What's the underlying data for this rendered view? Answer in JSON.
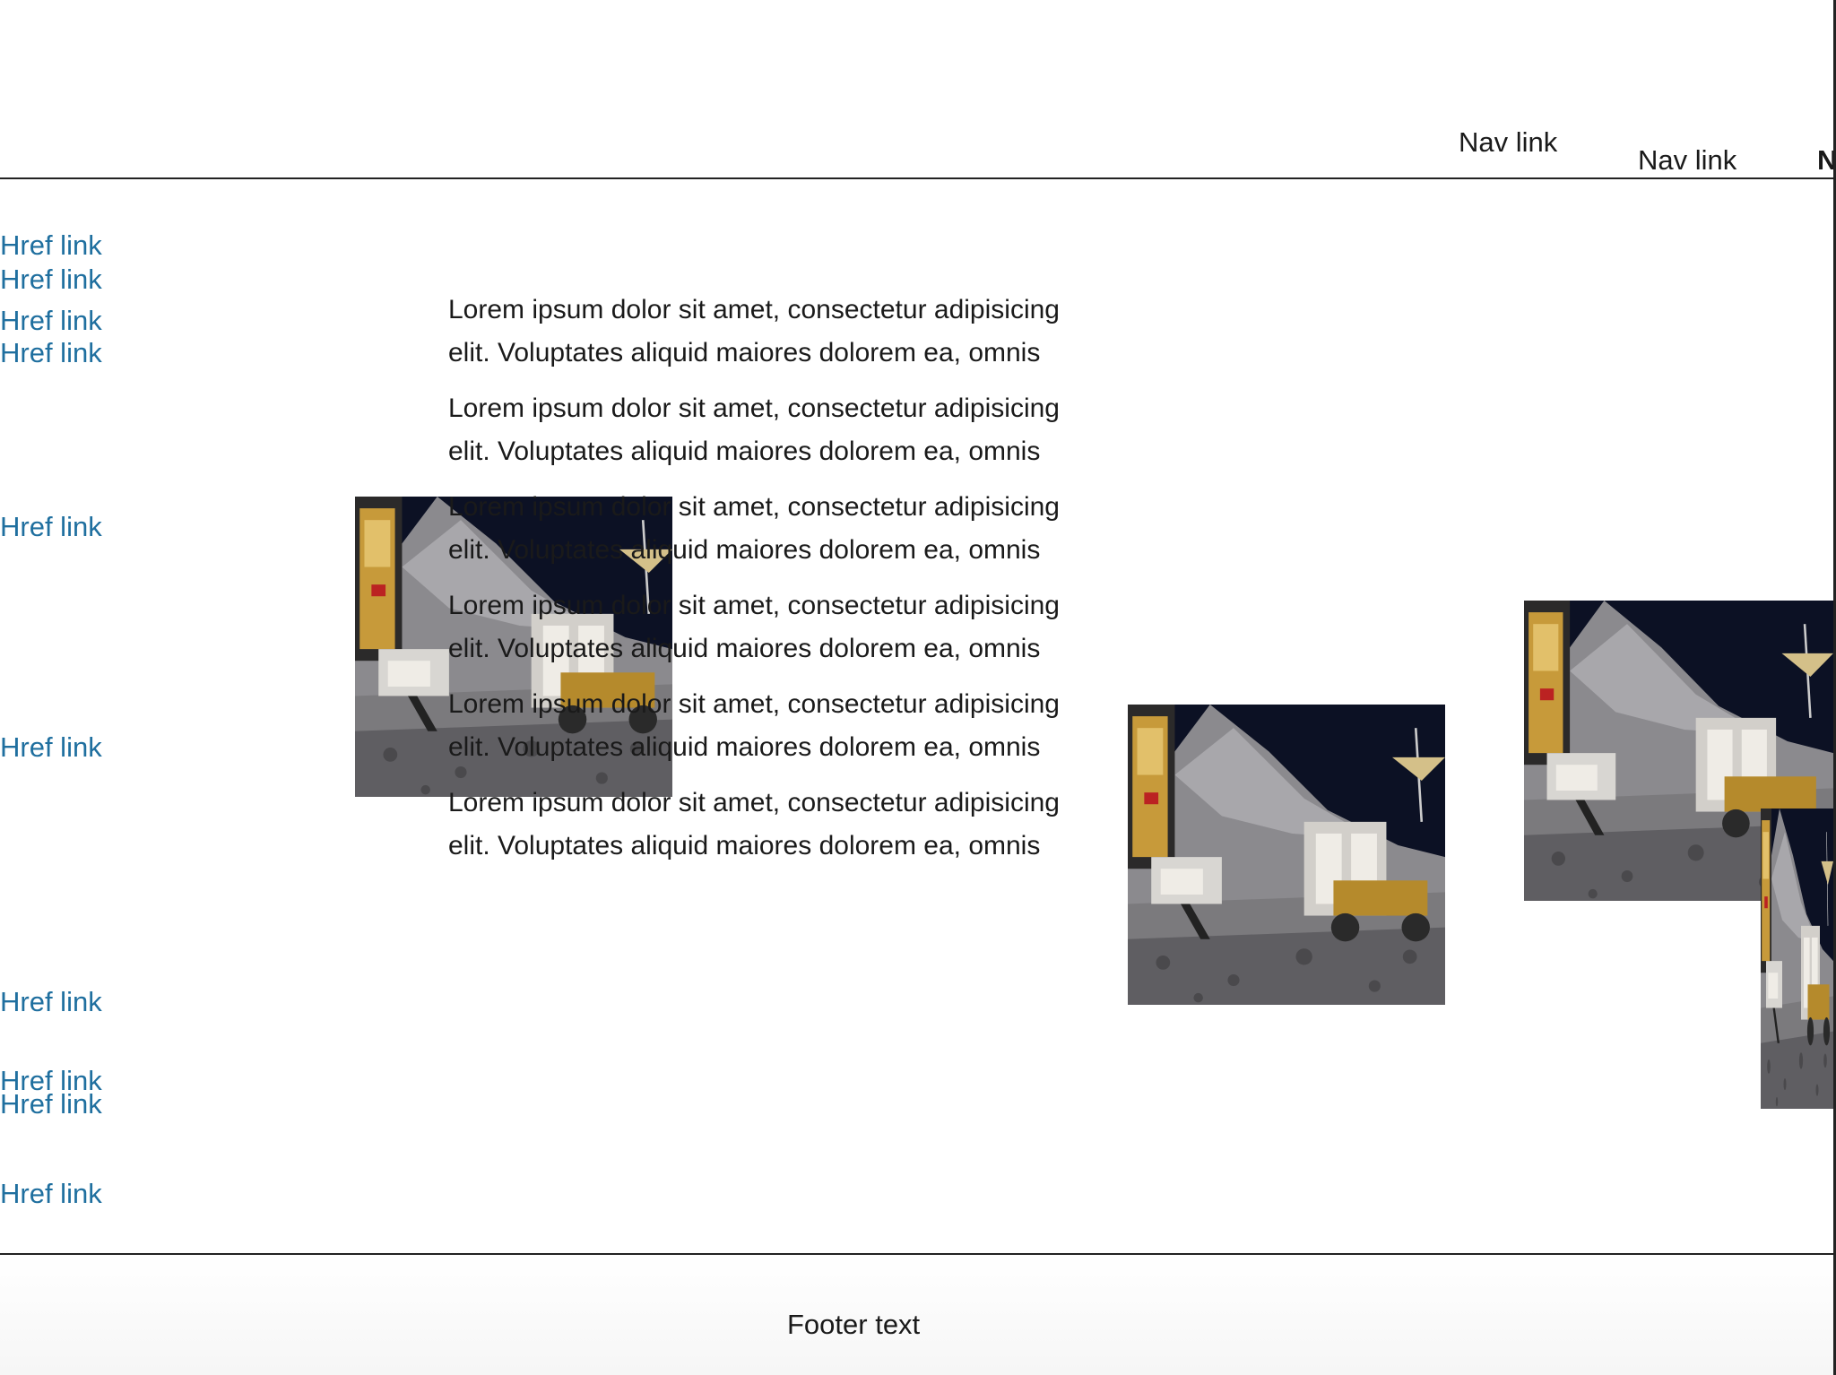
{
  "nav": {
    "links": [
      "Nav link",
      "Nav link",
      "N"
    ]
  },
  "sidebar": {
    "links": [
      "Href link",
      "Href link",
      "Href link",
      "Href link",
      "Href link",
      "Href link",
      "Href link",
      "Href link",
      "Href link",
      "Href link"
    ]
  },
  "main": {
    "paragraphs": [
      {
        "line1": "Lorem ipsum dolor sit amet, consectetur adipisicing",
        "line2": "elit. Voluptates aliquid maiores dolorem ea, omnis"
      },
      {
        "line1": "Lorem ipsum dolor sit amet, consectetur adipisicing",
        "line2": "elit. Voluptates aliquid maiores dolorem ea, omnis"
      },
      {
        "line1": "Lorem ipsum dolor sit amet, consectetur adipisicing",
        "line2": "elit. Voluptates aliquid maiores dolorem ea, omnis"
      },
      {
        "line1": "Lorem ipsum dolor sit amet, consectetur adipisicing",
        "line2": "elit. Voluptates aliquid maiores dolorem ea, omnis"
      },
      {
        "line1": "Lorem ipsum dolor sit amet, consectetur adipisicing",
        "line2": "elit. Voluptates aliquid maiores dolorem ea, omnis"
      },
      {
        "line1": "Lorem ipsum dolor sit amet, consectetur adipisicing",
        "line2": "elit. Voluptates aliquid maiores dolorem ea, omnis"
      }
    ]
  },
  "images": [
    {
      "subject": "lunar-rover-photo"
    },
    {
      "subject": "lunar-rover-photo"
    },
    {
      "subject": "lunar-rover-photo"
    },
    {
      "subject": "lunar-rover-photo"
    }
  ],
  "footer": {
    "text": "Footer text"
  },
  "colors": {
    "link": "#1f6f9f",
    "text": "#1a1a1a",
    "rule": "#222222"
  }
}
